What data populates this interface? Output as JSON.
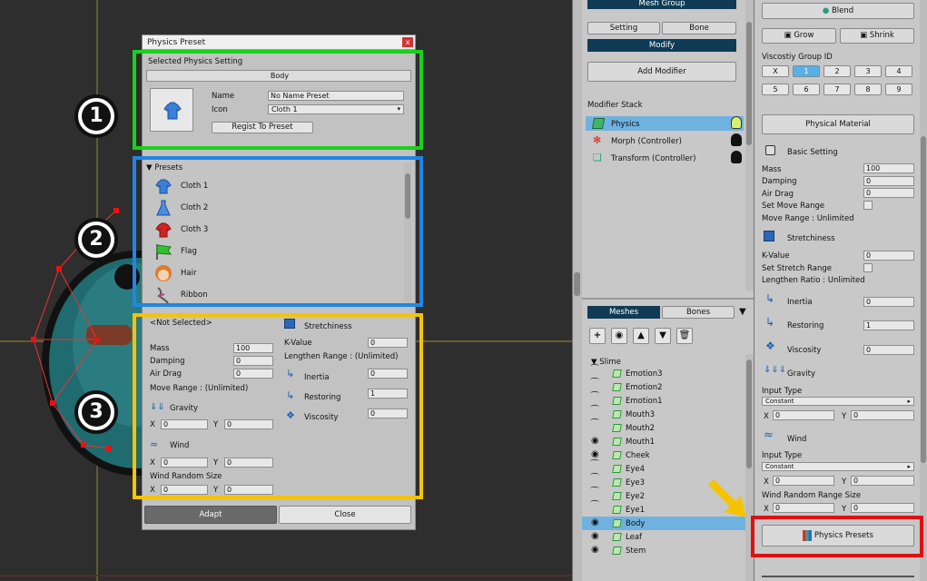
{
  "dialog": {
    "title": "Physics Preset",
    "close_glyph": "x",
    "selected_section_label": "Selected Physics Setting",
    "selected_name": "Body",
    "name_label": "Name",
    "name_value": "No Name Preset",
    "icon_label": "Icon",
    "icon_value": "Cloth 1",
    "regist_button": "Regist To Preset",
    "presets_header": "Presets",
    "presets": [
      {
        "label": "Cloth 1",
        "icon": "shirt-blue-icon"
      },
      {
        "label": "Cloth 2",
        "icon": "dress-blue-icon"
      },
      {
        "label": "Cloth 3",
        "icon": "shirt-red-icon"
      },
      {
        "label": "Flag",
        "icon": "flag-green-icon"
      },
      {
        "label": "Hair",
        "icon": "hair-face-icon"
      },
      {
        "label": "Ribbon",
        "icon": "ribbon-icon"
      }
    ],
    "not_selected": "<Not Selected>",
    "mass_label": "Mass",
    "mass_value": "100",
    "damping_label": "Damping",
    "damping_value": "0",
    "airdrag_label": "Air Drag",
    "airdrag_value": "0",
    "moverange_label": "Move Range : (Unlimited)",
    "gravity_label": "Gravity",
    "gx_label": "X",
    "gx_value": "0",
    "gy_label": "Y",
    "gy_value": "0",
    "wind_label": "Wind",
    "wx_label": "X",
    "wx_value": "0",
    "wy_label": "Y",
    "wy_value": "0",
    "windrandom_label": "Wind Random Size",
    "rx_label": "X",
    "rx_value": "0",
    "ry_label": "Y",
    "ry_value": "0",
    "stretch_label": "Stretchiness",
    "kvalue_label": "K-Value",
    "kvalue_value": "0",
    "lengthen_label": "Lengthen Range : (Unlimited)",
    "inertia_label": "Inertia",
    "inertia_value": "0",
    "restoring_label": "Restoring",
    "restoring_value": "1",
    "viscosity_label": "Viscosity",
    "viscosity_value": "0",
    "adapt_button": "Adapt",
    "close_button": "Close"
  },
  "badges": [
    "1",
    "2",
    "3"
  ],
  "mid": {
    "top_button": "Mesh Group",
    "setting_tab": "Setting",
    "bone_tab": "Bone",
    "modify_button": "Modify",
    "add_modifier": "Add Modifier",
    "modifier_stack_label": "Modifier Stack",
    "modifiers": [
      {
        "label": "Physics"
      },
      {
        "label": "Morph (Controller)"
      },
      {
        "label": "Transform (Controller)"
      }
    ],
    "meshes_tab": "Meshes",
    "bones_tab": "Bones",
    "tree_root": "Slime",
    "tree_items": [
      "Emotion3",
      "Emotion2",
      "Emotion1",
      "Mouth3",
      "Mouth2",
      "Mouth1",
      "Cheek",
      "Eye4",
      "Eye3",
      "Eye2",
      "Eye1",
      "Body",
      "Leaf",
      "Stem"
    ],
    "visible_items": [
      "Mouth1",
      "Cheek",
      "Body",
      "Leaf",
      "Stem"
    ]
  },
  "right": {
    "blend_button": "Blend",
    "grow_button": "Grow",
    "shrink_button": "Shrink",
    "viscosity_group_label": "Viscostiy Group ID",
    "group_clear": "X",
    "group_ids": [
      "1",
      "2",
      "3",
      "4",
      "5",
      "6",
      "7",
      "8",
      "9"
    ],
    "group_selected": "1",
    "physical_material": "Physical Material",
    "basic_setting": "Basic Setting",
    "mass_label": "Mass",
    "mass_value": "100",
    "damping_label": "Damping",
    "damping_value": "0",
    "airdrag_label": "Air Drag",
    "airdrag_value": "0",
    "setmove_label": "Set Move Range",
    "moverange_label": "Move Range : Unlimited",
    "stretch_label": "Stretchiness",
    "kvalue_label": "K-Value",
    "kvalue_value": "0",
    "setstretch_label": "Set Stretch Range",
    "lengthen_label": "Lengthen Ratio : Unlimited",
    "inertia_label": "Inertia",
    "inertia_value": "0",
    "restoring_label": "Restoring",
    "restoring_value": "1",
    "viscosity_label": "Viscosity",
    "viscosity_value": "0",
    "gravity_label": "Gravity",
    "input_type_label": "Input Type",
    "gravity_input": "Constant",
    "gx_label": "X",
    "gx_value": "0",
    "gy_label": "Y",
    "gy_value": "0",
    "wind_label": "Wind",
    "wind_input_label": "Input Type",
    "wind_input": "Constant",
    "wx_label": "X",
    "wx_value": "0",
    "wy_label": "Y",
    "wy_value": "0",
    "windrandom_label": "Wind Random Range Size",
    "rx_label": "X",
    "rx_value": "0",
    "ry_label": "Y",
    "ry_value": "0",
    "physics_presets_button": "Physics Presets"
  },
  "colors": {
    "green_box": "#1bd01b",
    "blue_box": "#1f86e6",
    "yellow_box": "#f5c400",
    "red_box": "#e01010",
    "arrow": "#f5c400"
  }
}
